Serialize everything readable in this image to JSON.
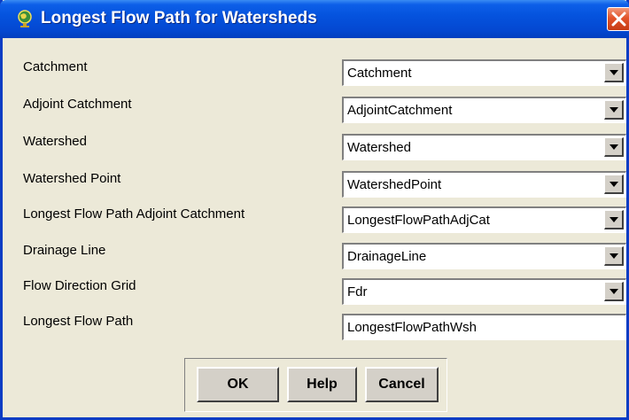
{
  "window": {
    "title": "Longest Flow Path for Watersheds",
    "icon": "globe-icon",
    "close_icon": "close-icon"
  },
  "fields": [
    {
      "label": "Catchment",
      "value": "Catchment",
      "type": "combo"
    },
    {
      "label": "Adjoint Catchment",
      "value": "AdjointCatchment",
      "type": "combo"
    },
    {
      "label": "Watershed",
      "value": "Watershed",
      "type": "combo"
    },
    {
      "label": "Watershed Point",
      "value": "WatershedPoint",
      "type": "combo"
    },
    {
      "label": "Longest Flow Path Adjoint Catchment",
      "value": "LongestFlowPathAdjCat",
      "type": "combo"
    },
    {
      "label": "Drainage Line",
      "value": "DrainageLine",
      "type": "combo"
    },
    {
      "label": "Flow Direction Grid",
      "value": "Fdr",
      "type": "combo"
    },
    {
      "label": "Longest Flow Path",
      "value": "LongestFlowPathWsh",
      "type": "text"
    }
  ],
  "buttons": {
    "ok": "OK",
    "help": "Help",
    "cancel": "Cancel"
  },
  "colors": {
    "titlebar": "#0553de",
    "dialog_bg": "#ece9d8",
    "close": "#e2542b"
  }
}
